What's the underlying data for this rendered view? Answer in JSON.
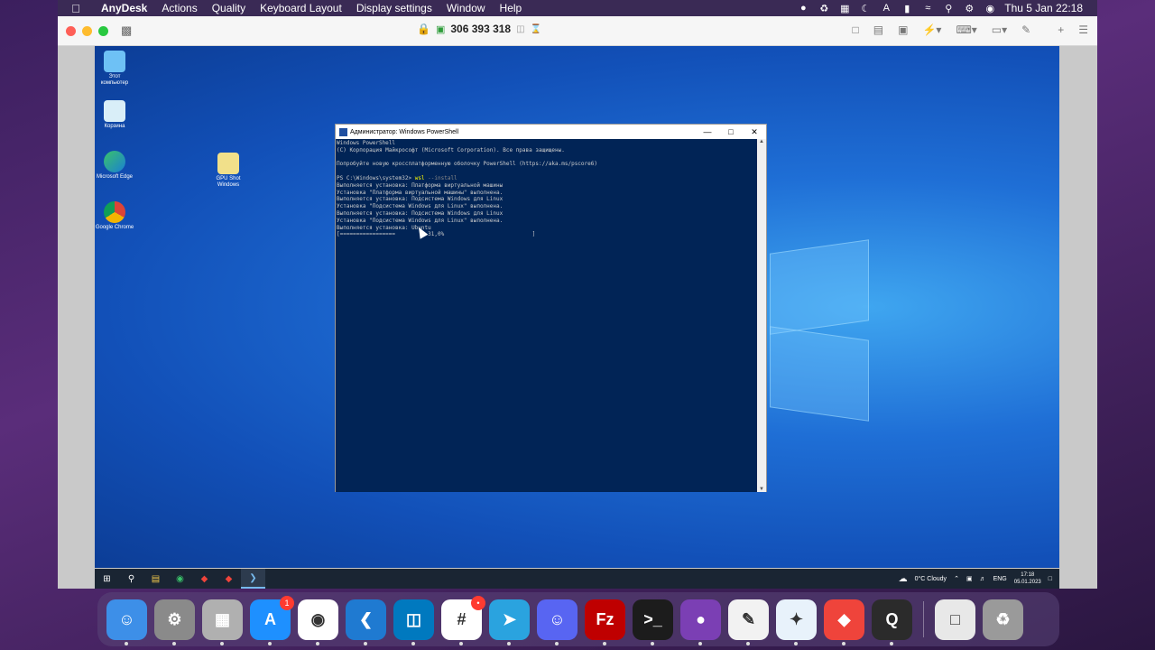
{
  "menubar": {
    "app_name": "AnyDesk",
    "items": [
      "Actions",
      "Quality",
      "Keyboard Layout",
      "Display settings",
      "Window",
      "Help"
    ],
    "clock": "Thu 5 Jan  22:18"
  },
  "anydesk": {
    "session_id": "306 393 318"
  },
  "desktop": {
    "icons": [
      {
        "label": "Этот компьютер",
        "icon": "computer-icon"
      },
      {
        "label": "Корзина",
        "icon": "recycle-bin-icon"
      },
      {
        "label": "Microsoft Edge",
        "icon": "edge-icon"
      },
      {
        "label": "Google Chrome",
        "icon": "chrome-icon"
      },
      {
        "label": "GPU Shot Windows",
        "icon": "folder-icon"
      }
    ]
  },
  "powershell": {
    "title": "Администратор: Windows PowerShell",
    "lines": [
      "Windows PowerShell",
      "(C) Корпорация Майкрософт (Microsoft Corporation). Все права защищены.",
      "",
      "Попробуйте новую кроссплатформенную оболочку PowerShell (https://aka.ms/pscore6)",
      ""
    ],
    "prompt": "PS C:\\Windows\\system32> ",
    "command": "wsl",
    "command_arg": " --install",
    "output": [
      "Выполняется установка: Платформа виртуальной машины",
      "Установка \"Платформа виртуальной машины\" выполнена.",
      "Выполняется установка: Подсистема Windows для Linux",
      "Установка \"Подсистема Windows для Linux\" выполнена.",
      "Выполняется установка: Подсистема Windows для Linux",
      "Установка \"Подсистема Windows для Linux\" выполнена.",
      "Выполняется установка: Ubuntu"
    ],
    "progress_line": "[=================          31,0%                           ]",
    "progress_percent": 31.0
  },
  "taskbar": {
    "weather": "0°C  Cloudy",
    "lang": "ENG",
    "time": "17:18",
    "date": "05.01.2023"
  },
  "dock": {
    "apps": [
      {
        "name": "Finder",
        "icon": "finder-icon",
        "color": "#3d8fe8"
      },
      {
        "name": "System Preferences",
        "icon": "gear-icon",
        "color": "#8a8a8a"
      },
      {
        "name": "Launchpad",
        "icon": "launchpad-icon",
        "color": "#b0b0b0"
      },
      {
        "name": "App Store",
        "icon": "app-store-icon",
        "color": "#1e90ff",
        "badge": "1"
      },
      {
        "name": "Google Chrome",
        "icon": "chrome-icon",
        "color": "#ffffff"
      },
      {
        "name": "Visual Studio Code",
        "icon": "vscode-icon",
        "color": "#1f7ad1"
      },
      {
        "name": "Trello",
        "icon": "trello-icon",
        "color": "#0079bf"
      },
      {
        "name": "Slack",
        "icon": "slack-icon",
        "color": "#ffffff",
        "badge": "•"
      },
      {
        "name": "Telegram",
        "icon": "telegram-icon",
        "color": "#2aa3df"
      },
      {
        "name": "Discord",
        "icon": "discord-icon",
        "color": "#5865f2"
      },
      {
        "name": "FileZilla",
        "icon": "filezilla-icon",
        "color": "#bf0000"
      },
      {
        "name": "Terminal",
        "icon": "terminal-icon",
        "color": "#1c1c1c"
      },
      {
        "name": "GitHub Desktop",
        "icon": "github-icon",
        "color": "#7b3fb4"
      },
      {
        "name": "TextEdit",
        "icon": "textedit-icon",
        "color": "#f2f2f2"
      },
      {
        "name": "Safari",
        "icon": "safari-icon",
        "color": "#e8f2fb"
      },
      {
        "name": "AnyDesk",
        "icon": "anydesk-icon",
        "color": "#ef443b"
      },
      {
        "name": "QuickTime Player",
        "icon": "quicktime-icon",
        "color": "#2b2b2b"
      }
    ],
    "trailing": [
      {
        "name": "Documents",
        "icon": "document-icon",
        "color": "#e8e8e8"
      },
      {
        "name": "Trash",
        "icon": "trash-icon",
        "color": "#9a9a9a"
      }
    ]
  }
}
